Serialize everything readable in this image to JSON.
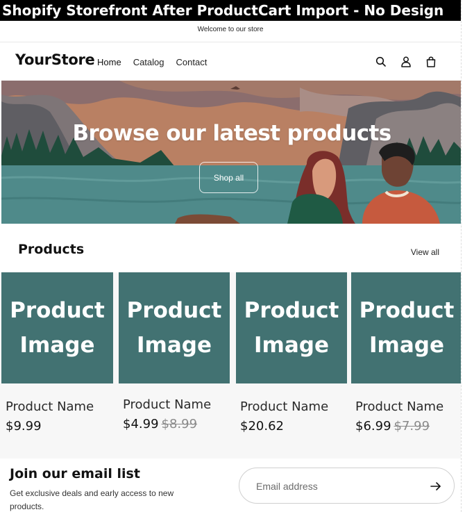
{
  "screenshot_title": "Shopify Storefront After ProductCart Import - No Design",
  "announcement": "Welcome to our store",
  "header": {
    "logo": "YourStore",
    "nav": [
      {
        "label": "Home",
        "active": true
      },
      {
        "label": "Catalog",
        "active": false
      },
      {
        "label": "Contact",
        "active": false
      }
    ],
    "icons": [
      "search-icon",
      "account-icon",
      "cart-icon"
    ]
  },
  "hero": {
    "heading": "Browse our latest products",
    "button": "Shop all"
  },
  "products": {
    "title": "Products",
    "view_all": "View all",
    "items": [
      {
        "image_line1": "Product",
        "image_line2": "Image",
        "name": "Product Name",
        "price": "$9.99",
        "compare_price": ""
      },
      {
        "image_line1": "Product",
        "image_line2": "Image",
        "name": "Product Name",
        "price": "$4.99",
        "compare_price": "$8.99"
      },
      {
        "image_line1": "Product",
        "image_line2": "Image",
        "name": "Product Name",
        "price": "$20.62",
        "compare_price": ""
      },
      {
        "image_line1": "Product",
        "image_line2": "Image",
        "name": "Product Name",
        "price": "$6.99",
        "compare_price": "$7.99"
      }
    ]
  },
  "newsletter": {
    "title": "Join our email list",
    "subtitle": "Get exclusive deals and early access to new products.",
    "placeholder": "Email address"
  },
  "colors": {
    "product_image_bg": "#427272",
    "banner_bg": "#000000",
    "hero_lake": "#4f8a8a"
  }
}
